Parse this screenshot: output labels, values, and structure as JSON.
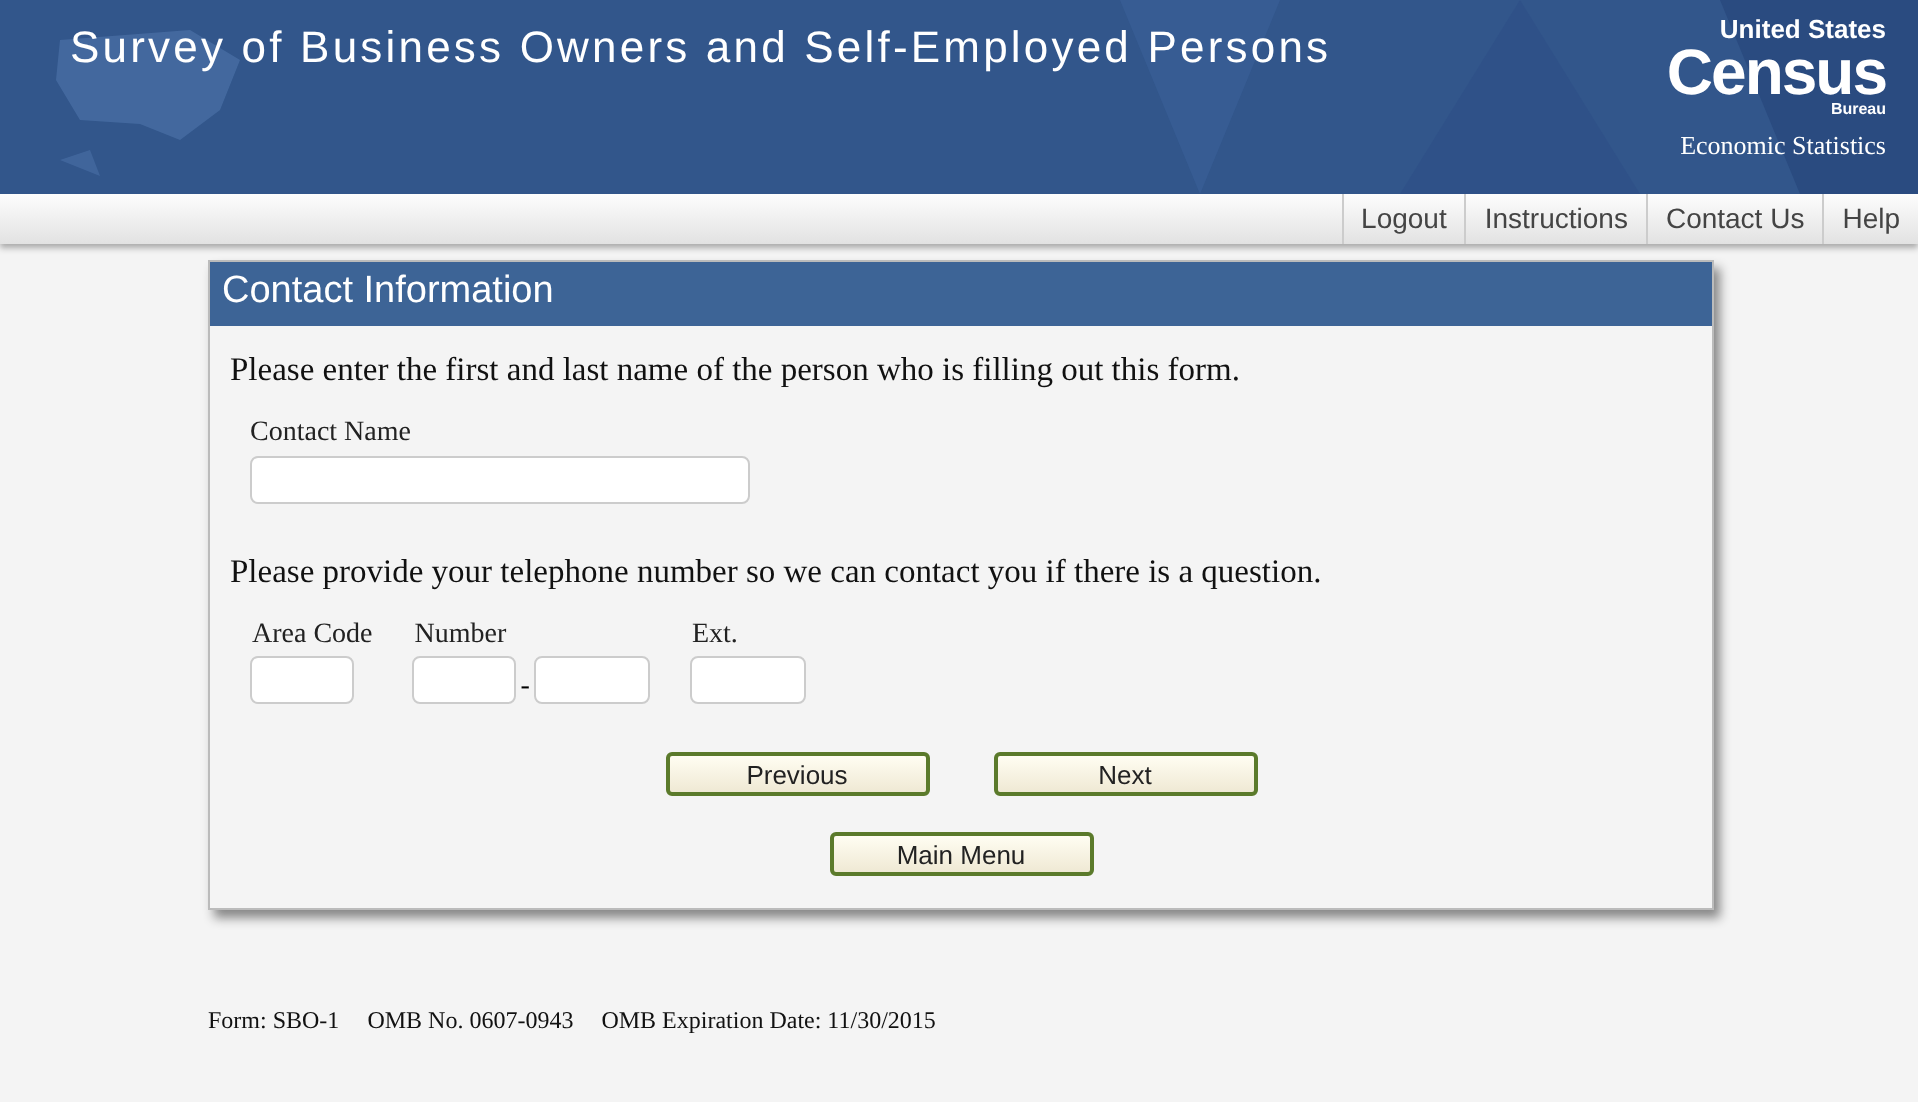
{
  "header": {
    "title": "Survey of Business Owners and Self-Employed Persons",
    "logo": {
      "top": "United States",
      "main": "Census",
      "sub": "Bureau",
      "division": "Economic Statistics"
    }
  },
  "nav": [
    "Logout",
    "Instructions",
    "Contact Us",
    "Help"
  ],
  "panel": {
    "title": "Contact Information",
    "name_prompt": "Please enter the first and last name of the person who is filling out this form.",
    "name_field": {
      "label": "Contact Name"
    },
    "phone_prompt": "Please provide your telephone number so we can contact you if there is a question.",
    "phone_fields": [
      {
        "label": "Area Code"
      },
      {
        "label": "Number",
        "separator": "-"
      },
      {
        "label": "Ext."
      }
    ],
    "buttons": [
      "Previous",
      "Next"
    ],
    "menu_button": "Main Menu"
  },
  "footer": [
    "Form: SBO-1",
    "OMB No. 0607-0943",
    "OMB Expiration Date: 11/30/2015"
  ]
}
